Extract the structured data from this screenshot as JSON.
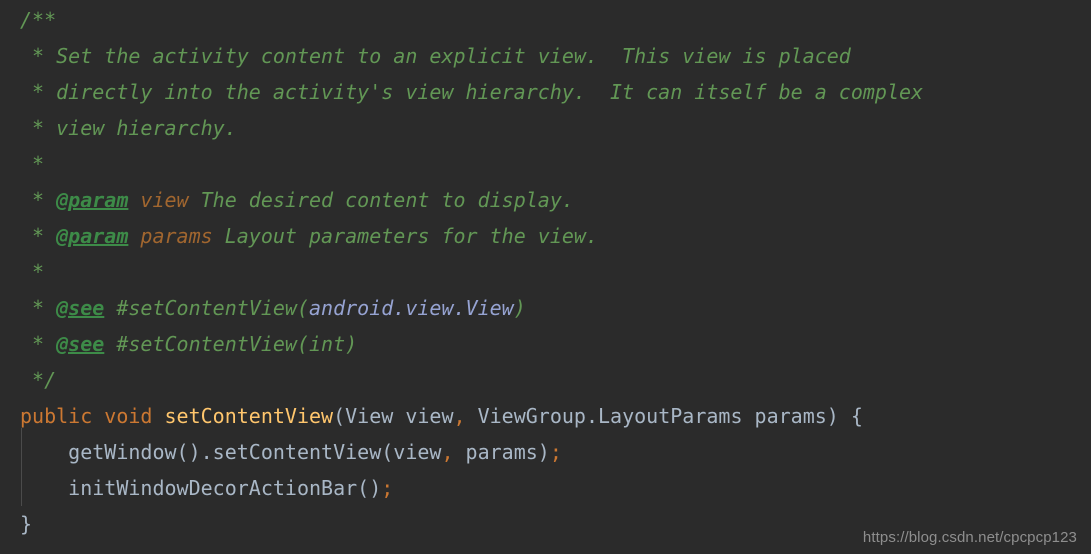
{
  "editor": {
    "background_color": "#2b2b2b",
    "language": "java",
    "theme": "darcula"
  },
  "colors": {
    "background": "#2b2b2b",
    "comment": "#629755",
    "javadoc_tag": "#3d8b48",
    "javadoc_param_name": "#a1662f",
    "javadoc_link": "#96a3d2",
    "keyword": "#cc7832",
    "method_name": "#ffc66d",
    "plain_text": "#a9b7c6",
    "indent_guide": "#4b4b4b",
    "watermark": "#8e8e8e"
  },
  "code": {
    "lines": [
      {
        "id": "line-1",
        "tokens": [
          {
            "text": "/**",
            "type": "comment"
          }
        ]
      },
      {
        "id": "line-2",
        "tokens": [
          {
            "text": " * Set the activity content to an explicit view.  This view is placed",
            "type": "comment"
          }
        ]
      },
      {
        "id": "line-3",
        "tokens": [
          {
            "text": " * directly into the activity's view hierarchy.  It can itself be a complex",
            "type": "comment"
          }
        ]
      },
      {
        "id": "line-4",
        "tokens": [
          {
            "text": " * view hierarchy.",
            "type": "comment"
          }
        ]
      },
      {
        "id": "line-5",
        "tokens": [
          {
            "text": " *",
            "type": "comment"
          }
        ]
      },
      {
        "id": "line-6",
        "tokens": [
          {
            "text": " * ",
            "type": "comment"
          },
          {
            "text": "@param",
            "type": "tag"
          },
          {
            "text": " ",
            "type": "comment"
          },
          {
            "text": "view",
            "type": "paramname"
          },
          {
            "text": " The desired content to display.",
            "type": "comment"
          }
        ]
      },
      {
        "id": "line-7",
        "tokens": [
          {
            "text": " * ",
            "type": "comment"
          },
          {
            "text": "@param",
            "type": "tag"
          },
          {
            "text": " ",
            "type": "comment"
          },
          {
            "text": "params",
            "type": "paramname"
          },
          {
            "text": " Layout parameters for the view.",
            "type": "comment"
          }
        ]
      },
      {
        "id": "line-8",
        "tokens": [
          {
            "text": " *",
            "type": "comment"
          }
        ]
      },
      {
        "id": "line-9",
        "tokens": [
          {
            "text": " * ",
            "type": "comment"
          },
          {
            "text": "@see",
            "type": "tag"
          },
          {
            "text": " #setContentView(",
            "type": "comment"
          },
          {
            "text": "android.view.View",
            "type": "link"
          },
          {
            "text": ")",
            "type": "comment"
          }
        ]
      },
      {
        "id": "line-10",
        "tokens": [
          {
            "text": " * ",
            "type": "comment"
          },
          {
            "text": "@see",
            "type": "tag"
          },
          {
            "text": " #setContentView(int)",
            "type": "comment"
          }
        ]
      },
      {
        "id": "line-11",
        "tokens": [
          {
            "text": " */",
            "type": "comment"
          }
        ]
      },
      {
        "id": "line-12",
        "tokens": [
          {
            "text": "public",
            "type": "keyword"
          },
          {
            "text": " ",
            "type": "plain"
          },
          {
            "text": "void",
            "type": "keyword"
          },
          {
            "text": " ",
            "type": "plain"
          },
          {
            "text": "setContentView",
            "type": "method"
          },
          {
            "text": "(View view",
            "type": "plain"
          },
          {
            "text": ",",
            "type": "punct"
          },
          {
            "text": " ViewGroup.LayoutParams params) {",
            "type": "plain"
          }
        ]
      },
      {
        "id": "line-13",
        "tokens": [
          {
            "text": "    getWindow().setContentView(view",
            "type": "plain"
          },
          {
            "text": ",",
            "type": "punct"
          },
          {
            "text": " params)",
            "type": "plain"
          },
          {
            "text": ";",
            "type": "punct"
          }
        ]
      },
      {
        "id": "line-14",
        "tokens": [
          {
            "text": "    initWindowDecorActionBar()",
            "type": "plain"
          },
          {
            "text": ";",
            "type": "punct"
          }
        ]
      },
      {
        "id": "line-15",
        "tokens": [
          {
            "text": "}",
            "type": "plain"
          }
        ]
      }
    ]
  },
  "watermark": {
    "text": "https://blog.csdn.net/cpcpcp123"
  }
}
